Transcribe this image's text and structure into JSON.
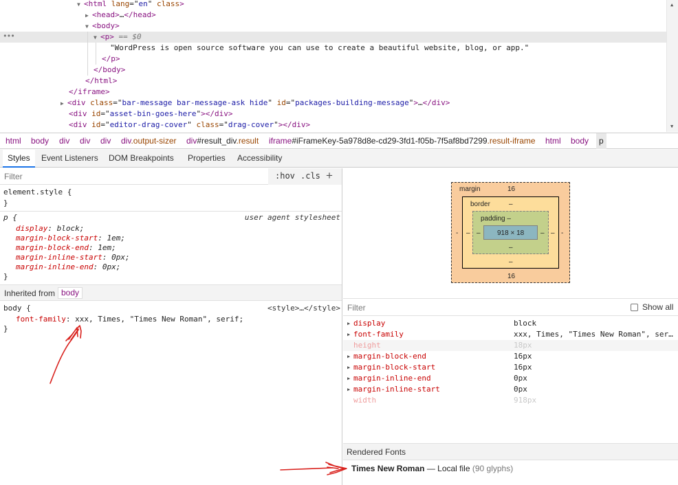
{
  "dom": {
    "lines": [
      {
        "parts": [
          [
            "tag",
            "<html "
          ],
          [
            "an",
            "lang"
          ],
          [
            "eq",
            "=\""
          ],
          [
            "av",
            "en"
          ],
          [
            "eq",
            "\" "
          ],
          [
            "an",
            "class"
          ],
          [
            "tag",
            ">"
          ]
        ]
      },
      {
        "parts": [
          [
            "tag",
            "<head>"
          ],
          [
            "eq",
            "…"
          ],
          [
            "tag",
            "</head>"
          ]
        ]
      },
      {
        "parts": [
          [
            "tag",
            "<body>"
          ]
        ]
      },
      {
        "parts": [
          [
            "tag",
            "<p>"
          ],
          [
            "dim",
            " == $0"
          ]
        ]
      },
      {
        "parts": [
          [
            "txt",
            "\"WordPress is open source software you can use to create a beautiful website, blog, or app.\""
          ]
        ]
      },
      {
        "parts": [
          [
            "tag",
            "</p>"
          ]
        ]
      },
      {
        "parts": [
          [
            "tag",
            "</body>"
          ]
        ]
      },
      {
        "parts": [
          [
            "tag",
            "</html>"
          ]
        ]
      },
      {
        "parts": [
          [
            "tag",
            "</iframe>"
          ]
        ]
      },
      {
        "parts": [
          [
            "tag",
            "<div "
          ],
          [
            "an",
            "class"
          ],
          [
            "eq",
            "=\""
          ],
          [
            "av",
            "bar-message bar-message-ask hide"
          ],
          [
            "eq",
            "\" "
          ],
          [
            "an",
            "id"
          ],
          [
            "eq",
            "=\""
          ],
          [
            "av",
            "packages-building-message"
          ],
          [
            "eq",
            "\""
          ],
          [
            "tag",
            ">"
          ],
          [
            "eq",
            "…"
          ],
          [
            "tag",
            "</div>"
          ]
        ]
      },
      {
        "parts": [
          [
            "tag",
            "<div "
          ],
          [
            "an",
            "id"
          ],
          [
            "eq",
            "=\""
          ],
          [
            "av",
            "asset-bin-goes-here"
          ],
          [
            "eq",
            "\""
          ],
          [
            "tag",
            "></div>"
          ]
        ]
      },
      {
        "parts": [
          [
            "tag",
            "<div "
          ],
          [
            "an",
            "id"
          ],
          [
            "eq",
            "=\""
          ],
          [
            "av",
            "editor-drag-cover"
          ],
          [
            "eq",
            "\" "
          ],
          [
            "an",
            "class"
          ],
          [
            "eq",
            "=\""
          ],
          [
            "av",
            "drag-cover"
          ],
          [
            "eq",
            "\""
          ],
          [
            "tag",
            "></div>"
          ]
        ]
      }
    ],
    "ellipsis": "•••"
  },
  "breadcrumbs": [
    {
      "tag": "html"
    },
    {
      "tag": "body"
    },
    {
      "tag": "div"
    },
    {
      "tag": "div"
    },
    {
      "tag": "div"
    },
    {
      "tag": "div",
      "cls": ".output-sizer"
    },
    {
      "tag": "div",
      "sel": "#result_div",
      "cls": ".result"
    },
    {
      "tag": "iframe",
      "sel": "#iFrameKey-5a978d8e-cd29-3fd1-f05b-7f5af8bd7299",
      "cls": ".result-iframe"
    },
    {
      "tag": "html"
    },
    {
      "tag": "body"
    },
    {
      "tag": "p"
    }
  ],
  "tabs": [
    "Styles",
    "Event Listeners",
    "DOM Breakpoints",
    "Properties",
    "Accessibility"
  ],
  "styles": {
    "filter_placeholder": "Filter",
    "hov": ":hov",
    "cls": ".cls",
    "plus": "+",
    "element_style_open": "element.style {",
    "element_style_close": "}",
    "p_rule": {
      "selector": "p {",
      "source": "user agent stylesheet",
      "props": [
        {
          "name": "display",
          "value": "block;"
        },
        {
          "name": "margin-block-start",
          "value": "1em;"
        },
        {
          "name": "margin-block-end",
          "value": "1em;"
        },
        {
          "name": "margin-inline-start",
          "value": "0px;"
        },
        {
          "name": "margin-inline-end",
          "value": "0px;"
        }
      ],
      "close": "}"
    },
    "inherited_label": "Inherited from",
    "inherited_tag": "body",
    "body_rule": {
      "selector": "body {",
      "source": "<style>…</style>",
      "prop_name": "font-family",
      "prop_value": "xxx, Times, \"Times New Roman\", serif;",
      "close": "}"
    }
  },
  "box_model": {
    "margin_label": "margin",
    "margin_top": "16",
    "margin_bottom": "16",
    "margin_left": "-",
    "margin_right": "-",
    "border_label": "border",
    "border_top": "–",
    "border_bottom": "–",
    "border_left": "–",
    "border_right": "–",
    "padding_label": "padding –",
    "padding_bottom": "–",
    "padding_left": "–",
    "padding_right": "–",
    "content": "918 × 18"
  },
  "computed": {
    "filter_placeholder": "Filter",
    "show_all": "Show all",
    "rows": [
      {
        "name": "display",
        "value": "block",
        "expandable": true,
        "inherited": false
      },
      {
        "name": "font-family",
        "value": "xxx, Times, \"Times New Roman\", ser…",
        "expandable": true,
        "inherited": false
      },
      {
        "name": "height",
        "value": "18px",
        "expandable": false,
        "inherited": true
      },
      {
        "name": "margin-block-end",
        "value": "16px",
        "expandable": true,
        "inherited": false
      },
      {
        "name": "margin-block-start",
        "value": "16px",
        "expandable": true,
        "inherited": false
      },
      {
        "name": "margin-inline-end",
        "value": "0px",
        "expandable": true,
        "inherited": false
      },
      {
        "name": "margin-inline-start",
        "value": "0px",
        "expandable": true,
        "inherited": false
      },
      {
        "name": "width",
        "value": "918px",
        "expandable": false,
        "inherited": true
      }
    ]
  },
  "rendered_fonts": {
    "title": "Rendered Fonts",
    "font_name": "Times New Roman",
    "dash": " — ",
    "source": "Local file ",
    "glyphs": "(90 glyphs)"
  },
  "colors": {
    "annotation_red": "#d9221e"
  }
}
